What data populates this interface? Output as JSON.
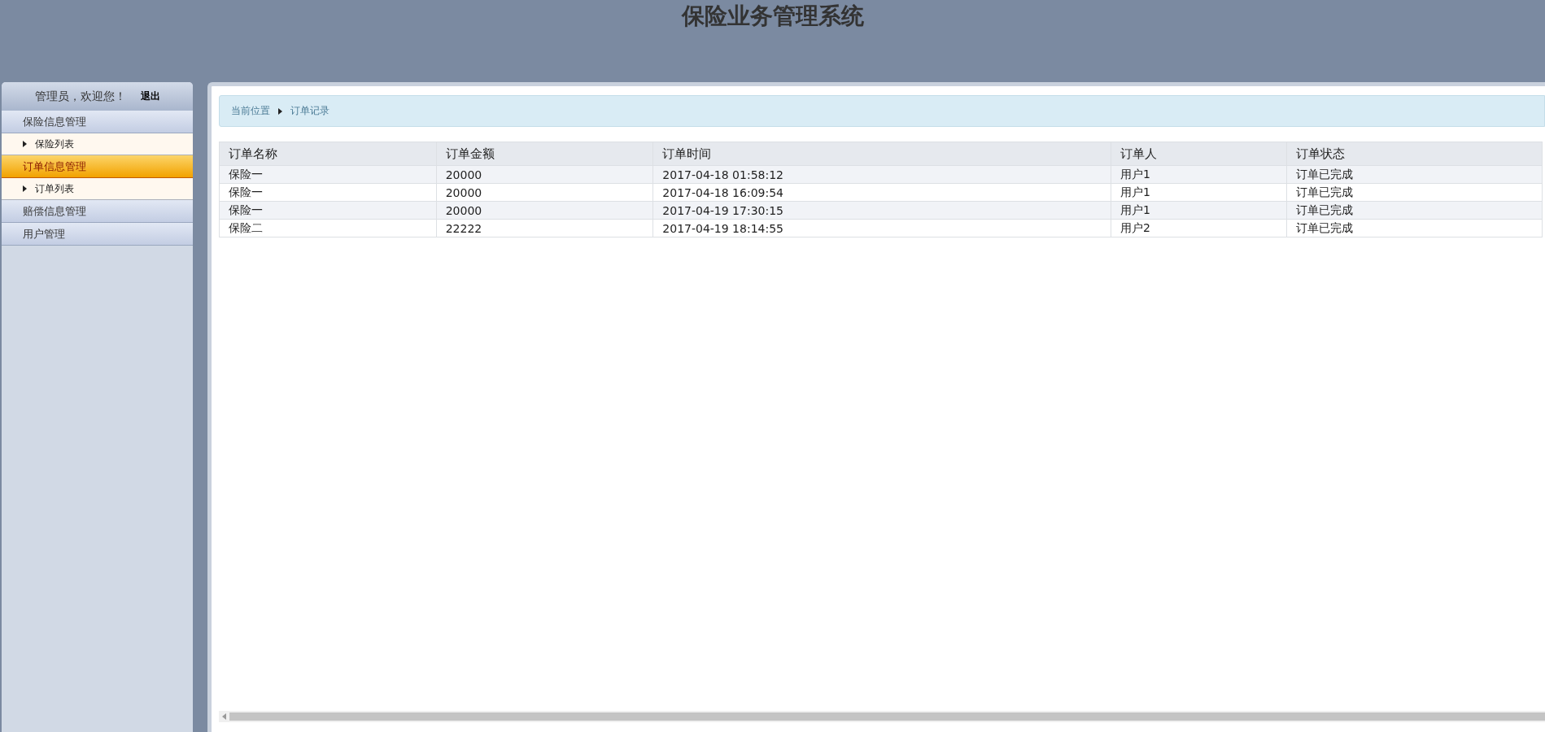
{
  "header": {
    "title": "保险业务管理系统"
  },
  "sidebar": {
    "welcome": "管理员，欢迎您！",
    "logout": "退出",
    "groups": [
      {
        "label": "保险信息管理",
        "selected": false,
        "children": [
          {
            "label": "保险列表"
          }
        ]
      },
      {
        "label": "订单信息管理",
        "selected": true,
        "children": [
          {
            "label": "订单列表"
          }
        ]
      },
      {
        "label": "赔偿信息管理",
        "selected": false
      },
      {
        "label": "用户管理",
        "selected": false
      }
    ]
  },
  "breadcrumb": {
    "label": "当前位置",
    "current": "订单记录"
  },
  "table": {
    "columns": [
      "订单名称",
      "订单金额",
      "订单时间",
      "订单人",
      "订单状态"
    ],
    "rows": [
      [
        "保险一",
        "20000",
        "2017-04-18 01:58:12",
        "用户1",
        "订单已完成"
      ],
      [
        "保险一",
        "20000",
        "2017-04-18 16:09:54",
        "用户1",
        "订单已完成"
      ],
      [
        "保险一",
        "20000",
        "2017-04-19 17:30:15",
        "用户1",
        "订单已完成"
      ],
      [
        "保险二",
        "22222",
        "2017-04-19 18:14:55",
        "用户2",
        "订单已完成"
      ]
    ]
  }
}
